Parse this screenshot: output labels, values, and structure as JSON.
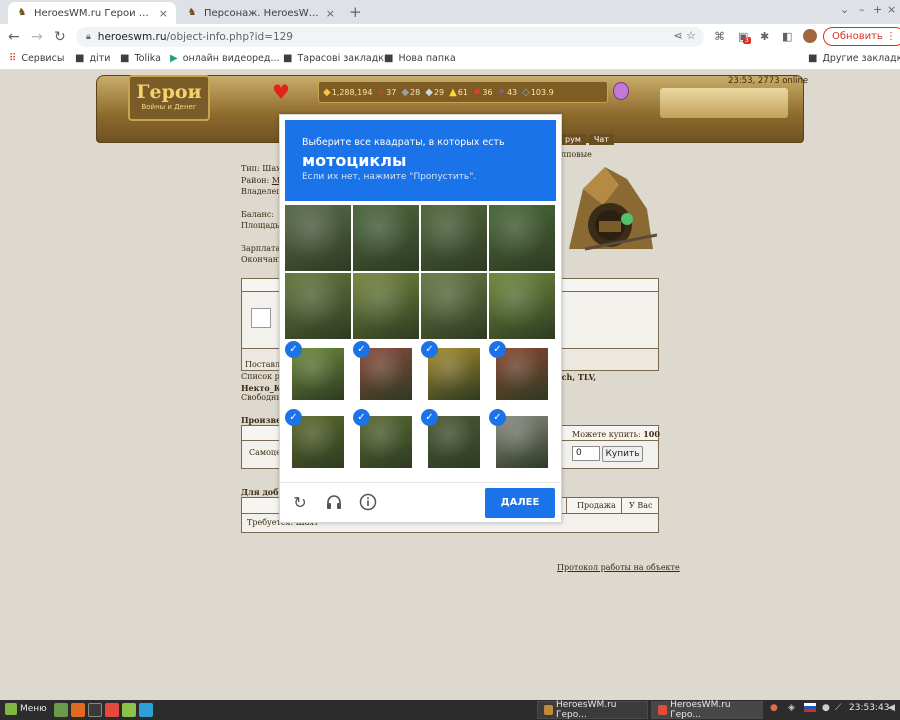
{
  "tabs": [
    {
      "title": "HeroesWM.ru Герои войны и ...",
      "active": true
    },
    {
      "title": "Персонаж. HeroesWM.ru Геро...",
      "active": false
    }
  ],
  "window_controls": {
    "chevron": "⌄",
    "min": "–",
    "max": "+",
    "close": "×"
  },
  "omnibox": {
    "host": "heroeswm.ru",
    "path": "/object-info.php?id=129"
  },
  "ext_badge": "3",
  "update_button": "Обновить",
  "bookmarks": [
    "Сервисы",
    "діти",
    "Tolika",
    "онлайн видеоред...",
    "Тарасові закладки",
    "Нова папка"
  ],
  "other_bookmarks": "Другие закладки",
  "game": {
    "logo_title": "Герои",
    "logo_subtitle": "Войны и Денег",
    "online": "23:53, 2773 online",
    "resources": [
      {
        "icon": "gold-icon",
        "value": "1,288,194",
        "color": "#f2c94c"
      },
      {
        "icon": "wood-icon",
        "value": "37",
        "color": "#a0522d"
      },
      {
        "icon": "ore-icon",
        "value": "28",
        "color": "#9e9e9e"
      },
      {
        "icon": "mercury-icon",
        "value": "29",
        "color": "#cfd8dc"
      },
      {
        "icon": "sulfur-icon",
        "value": "61",
        "color": "#fdd835"
      },
      {
        "icon": "crystal-icon",
        "value": "36",
        "color": "#e53935"
      },
      {
        "icon": "gems-icon",
        "value": "43",
        "color": "#ab47bc"
      },
      {
        "icon": "diamond-icon",
        "value": "103.9",
        "color": "#4fc3f7"
      }
    ],
    "nav_tabs": [
      "рум",
      "Чат"
    ]
  },
  "object_info": {
    "type_label": "Тип: Шахт",
    "district_label": "Район:",
    "district_value": "Mi",
    "owner_label": "Владелец:",
    "balance_label": "Баланс:",
    "area_label": "Площадь:",
    "salary_label": "Зарплата:",
    "end_label": "Окончани",
    "right_label": "лповые",
    "supply_label": "Поставл",
    "list_label": "Список ра",
    "list_names": "ych, TLV,",
    "name2": "Некто_К",
    "free_label": "Свободны",
    "produced_label": "Произвед",
    "can_buy_label": "Можете купить:",
    "can_buy_value": "100",
    "self_label": "Самоце",
    "quantity": "0",
    "buy_button": "Купить",
    "for_production_label": "Для добы",
    "sale_header": "Продажа",
    "you_have_header": "У Вас",
    "required_label": "Требуется: Шахт",
    "protocol_link": "Протокол работы на объекте"
  },
  "captcha": {
    "instruction": "Выберите все квадраты, в которых есть",
    "target": "мотоциклы",
    "skip_hint": "Если их нет, нажмите \"Пропустить\".",
    "next_button": "ДАЛЕЕ",
    "tiles": [
      {
        "selected": false,
        "color": "#5b6b4b"
      },
      {
        "selected": false,
        "color": "#4e6a3f"
      },
      {
        "selected": false,
        "color": "#53683f"
      },
      {
        "selected": false,
        "color": "#4a6a3a"
      },
      {
        "selected": false,
        "color": "#66793f"
      },
      {
        "selected": false,
        "color": "#76883f"
      },
      {
        "selected": false,
        "color": "#6a7b48"
      },
      {
        "selected": false,
        "color": "#6f8a3d"
      },
      {
        "selected": true,
        "color": "#6d8a3c"
      },
      {
        "selected": true,
        "color": "#8a4a3c"
      },
      {
        "selected": true,
        "color": "#a38a2c"
      },
      {
        "selected": true,
        "color": "#8a4632"
      },
      {
        "selected": true,
        "color": "#5d6b2d"
      },
      {
        "selected": true,
        "color": "#5a6b34"
      },
      {
        "selected": true,
        "color": "#4c5b38"
      },
      {
        "selected": true,
        "color": "#8a8d86"
      }
    ]
  },
  "taskbar": {
    "menu": "Меню",
    "windows": [
      "HeroesWM.ru Геро...",
      "HeroesWM.ru Геро..."
    ],
    "clock": "23:53:43"
  }
}
